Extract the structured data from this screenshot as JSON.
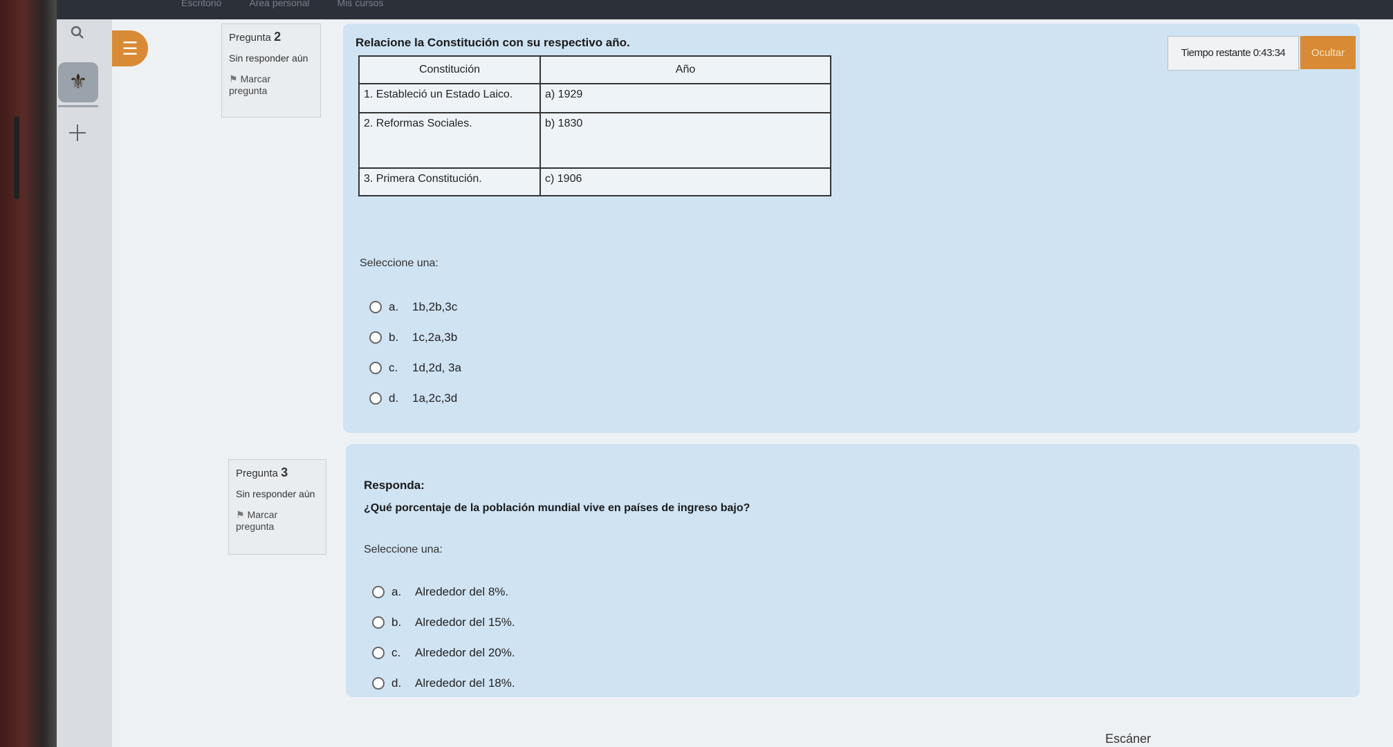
{
  "topbar": {
    "nav": [
      "Escritorio",
      "Área personal",
      "Mis cursos"
    ]
  },
  "rail": {
    "search_icon": "search-icon",
    "add_icon": "plus-icon",
    "avatar_icon": "crest-icon"
  },
  "drawer": {
    "icon": "list-icon",
    "glyph": "☰"
  },
  "timer": {
    "label": "Tiempo restante 0:43:34"
  },
  "hide_button": {
    "label": "Ocultar"
  },
  "question2": {
    "number_label": "Pregunta",
    "number": "2",
    "status": "Sin responder aún",
    "flag_label_1": "Marcar",
    "flag_label_2": "pregunta",
    "text": "Relacione la Constitución con su respectivo año.",
    "table": {
      "headers": [
        "Constitución",
        "Año"
      ],
      "rows": [
        [
          "1.  Estableció un Estado Laico.",
          "a)   1929"
        ],
        [
          "2.  Reformas Sociales.",
          "b)   1830"
        ],
        [
          "3.  Primera Constitución.",
          "c)   1906"
        ]
      ]
    },
    "prompt": "Seleccione una:",
    "options": [
      {
        "letter": "a.",
        "text": "1b,2b,3c"
      },
      {
        "letter": "b.",
        "text": "1c,2a,3b"
      },
      {
        "letter": "c.",
        "text": "1d,2d, 3a"
      },
      {
        "letter": "d.",
        "text": "1a,2c,3d"
      }
    ]
  },
  "question3": {
    "number_label": "Pregunta",
    "number": "3",
    "status": "Sin responder aún",
    "flag_label_1": "Marcar",
    "flag_label_2": "pregunta",
    "heading": "Responda:",
    "text": "¿Qué porcentaje de la población mundial vive en países de ingreso bajo?",
    "prompt": "Seleccione una:",
    "options": [
      {
        "letter": "a.",
        "text": "Alrededor del 8%."
      },
      {
        "letter": "b.",
        "text": "Alrededor del 15%."
      },
      {
        "letter": "c.",
        "text": "Alrededor del 20%."
      },
      {
        "letter": "d.",
        "text": "Alrededor del 18%."
      }
    ]
  },
  "taskbar": {
    "scanner": "Escáner"
  }
}
